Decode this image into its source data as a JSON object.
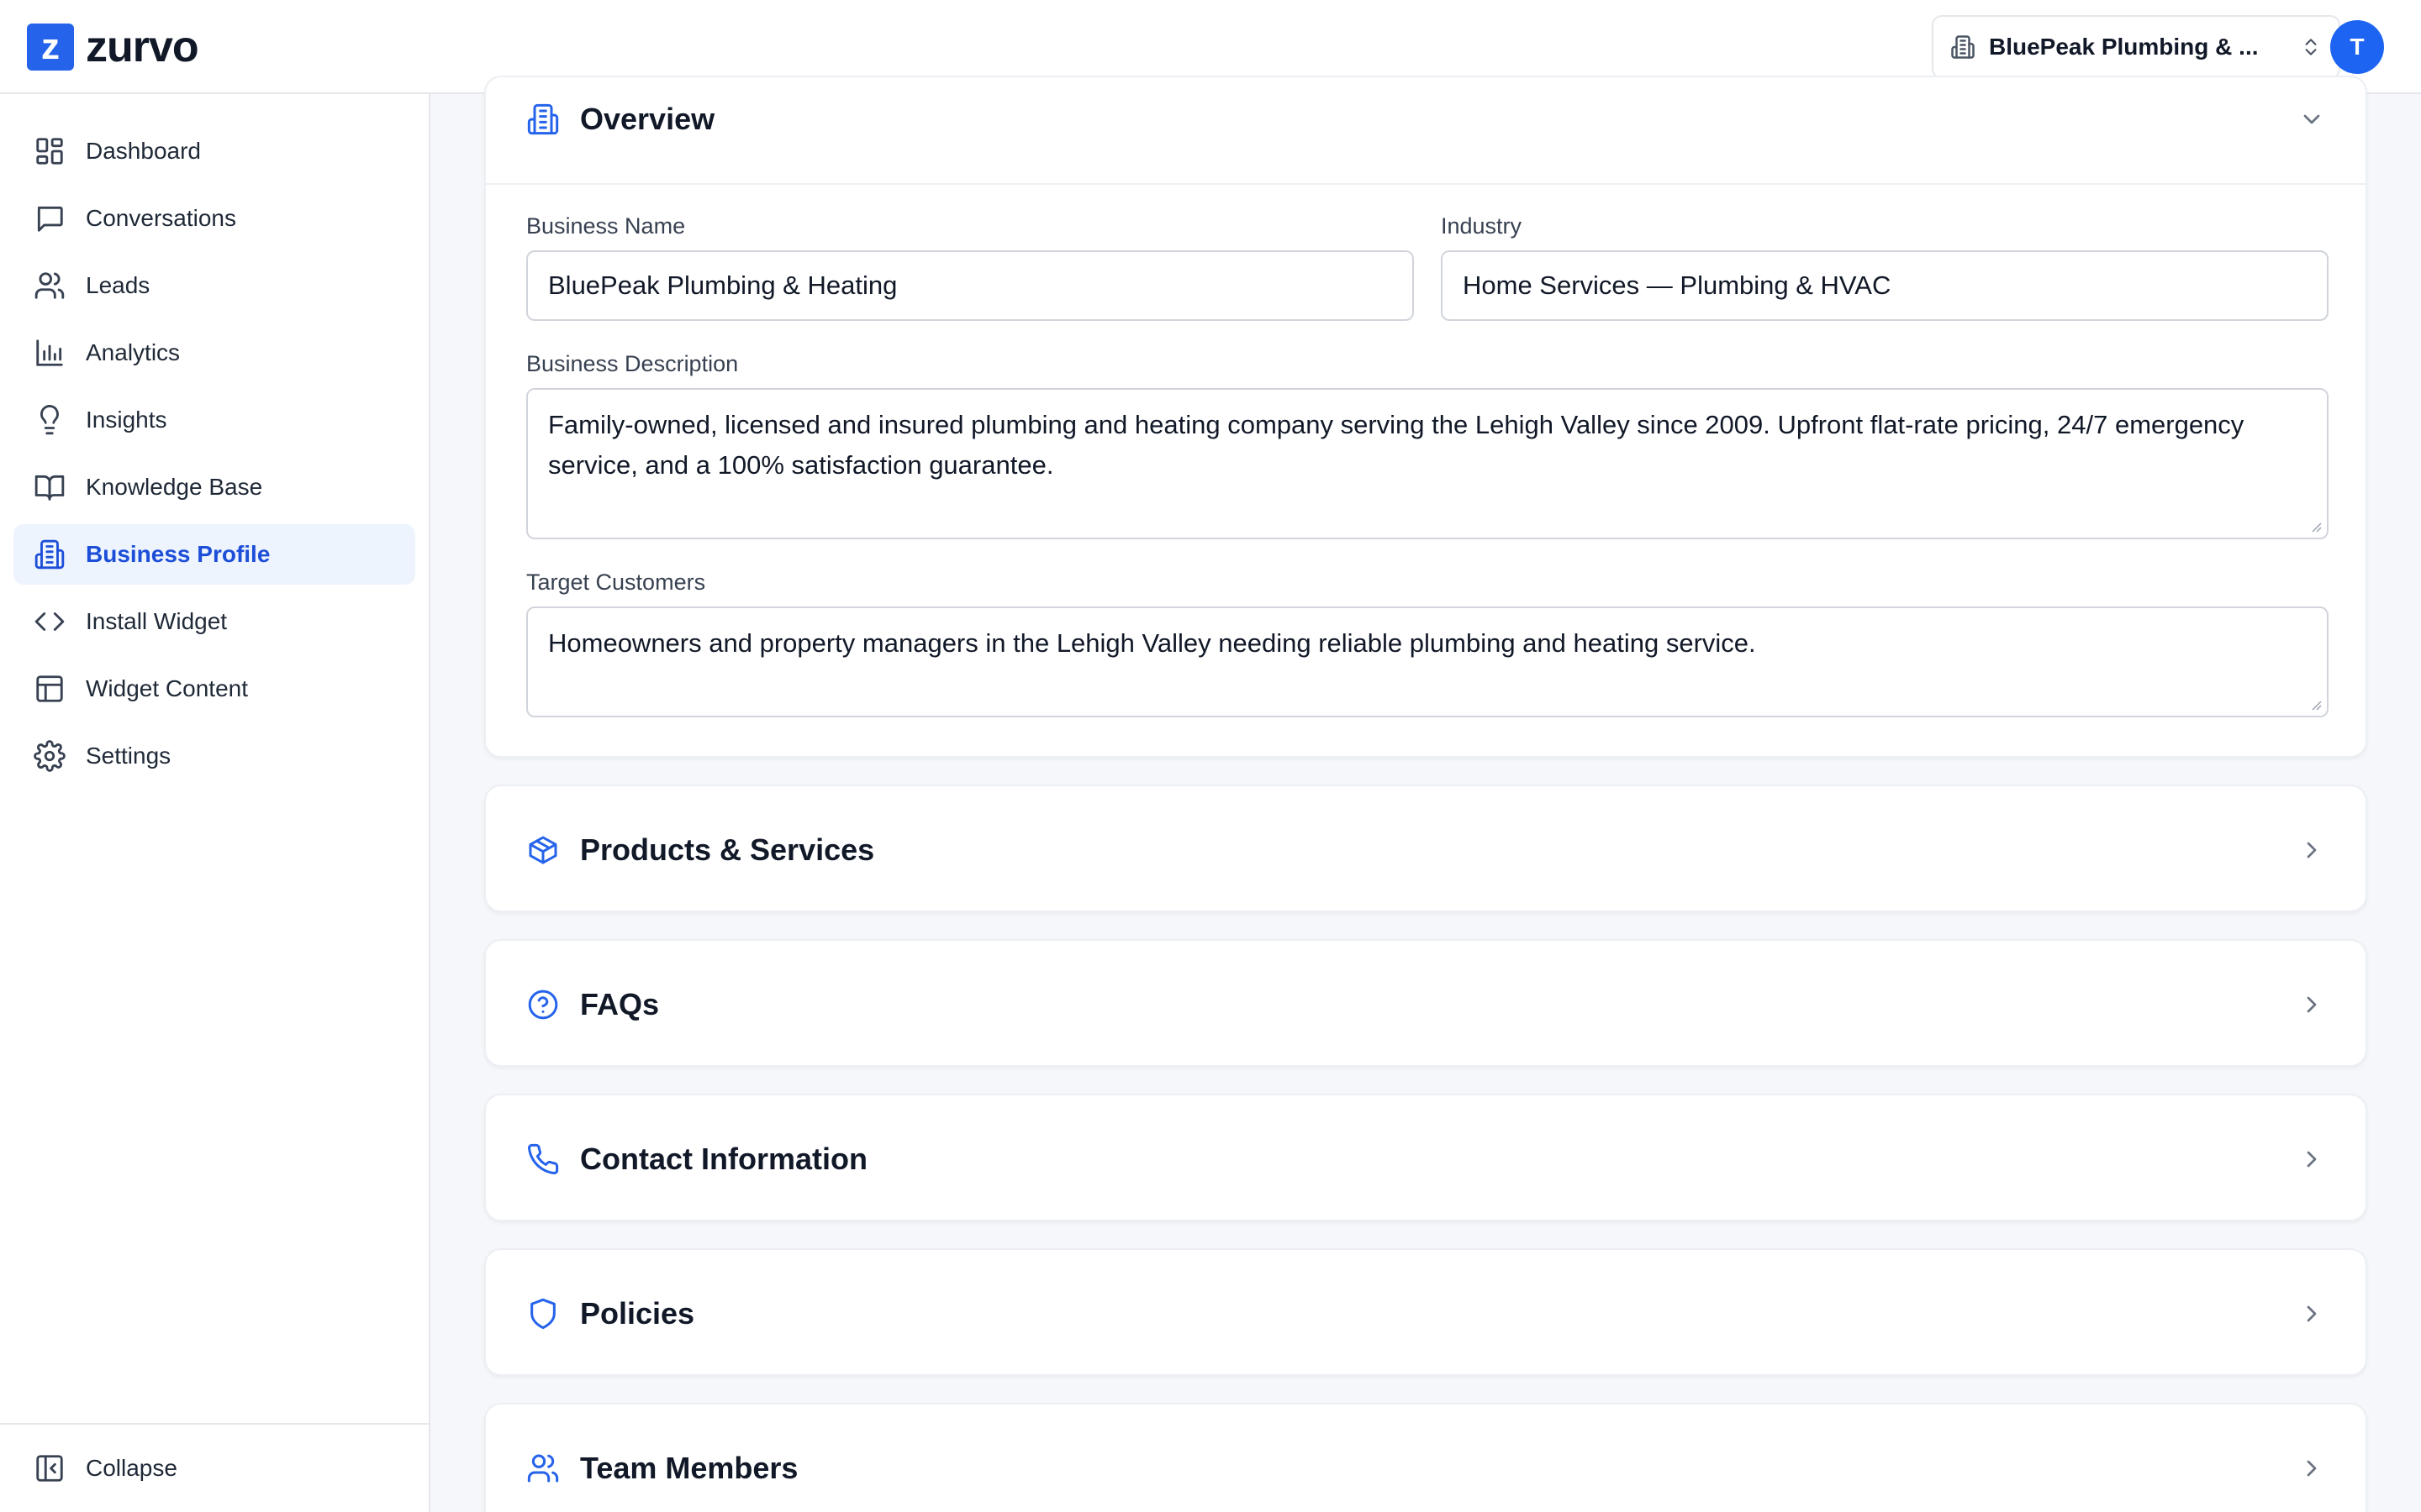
{
  "app": {
    "logo_letter": "z",
    "logo_name": "zurvo",
    "workspace": "BluePeak Plumbing & ...",
    "avatar_initial": "T"
  },
  "sidebar": {
    "items": [
      {
        "label": "Dashboard",
        "icon": "dashboard-icon"
      },
      {
        "label": "Conversations",
        "icon": "chat-icon"
      },
      {
        "label": "Leads",
        "icon": "users-icon"
      },
      {
        "label": "Analytics",
        "icon": "bar-chart-icon"
      },
      {
        "label": "Insights",
        "icon": "lightbulb-icon"
      },
      {
        "label": "Knowledge Base",
        "icon": "book-icon"
      },
      {
        "label": "Business Profile",
        "icon": "building-icon",
        "active": true
      },
      {
        "label": "Install Widget",
        "icon": "code-icon"
      },
      {
        "label": "Widget Content",
        "icon": "layout-icon"
      },
      {
        "label": "Settings",
        "icon": "gear-icon"
      }
    ],
    "collapse_label": "Collapse"
  },
  "overview": {
    "title": "Overview",
    "business_name_label": "Business Name",
    "business_name_value": "BluePeak Plumbing & Heating",
    "industry_label": "Industry",
    "industry_value": "Home Services — Plumbing & HVAC",
    "description_label": "Business Description",
    "description_value": "Family-owned, licensed and insured plumbing and heating company serving the Lehigh Valley since 2009. Upfront flat-rate pricing, 24/7 emergency service, and a 100% satisfaction guarantee.",
    "target_label": "Target Customers",
    "target_value": "Homeowners and property managers in the Lehigh Valley needing reliable plumbing and heating service."
  },
  "sections": [
    {
      "title": "Products & Services",
      "icon": "package-icon"
    },
    {
      "title": "FAQs",
      "icon": "help-circle-icon"
    },
    {
      "title": "Contact Information",
      "icon": "phone-icon"
    },
    {
      "title": "Policies",
      "icon": "shield-icon"
    },
    {
      "title": "Team Members",
      "icon": "users-icon"
    }
  ],
  "colors": {
    "accent": "#2563eb",
    "active_bg": "#eef4fe",
    "active_text": "#1d4ed8",
    "page_bg": "#f5f7fa"
  }
}
